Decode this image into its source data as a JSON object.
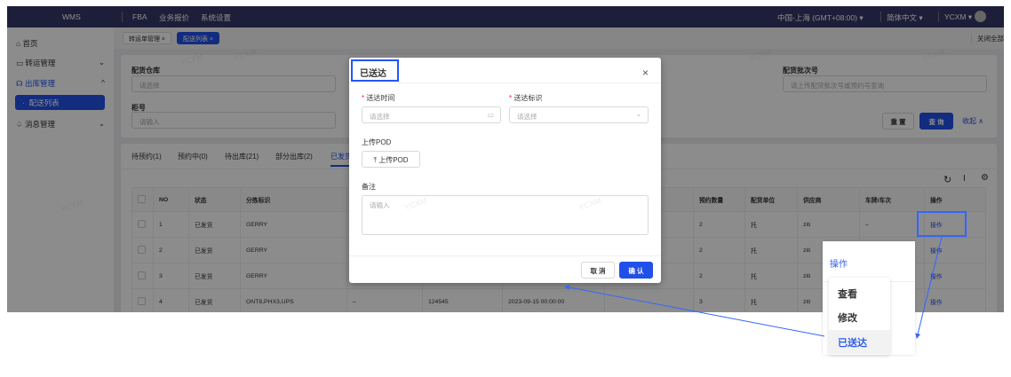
{
  "header": {
    "logo": "WMS",
    "nav": [
      "FBA",
      "业务报价",
      "系统设置"
    ],
    "timezone": "中国-上海 (GMT+08:00)",
    "language": "简体中文",
    "user": "YCXM"
  },
  "sidebar": {
    "items": [
      {
        "label": "首页",
        "icon": "home-icon"
      },
      {
        "label": "转运管理",
        "icon": "truck-icon"
      },
      {
        "label": "出库管理",
        "icon": "headset-icon"
      },
      {
        "label": "配送列表",
        "active": true
      },
      {
        "label": "消息管理",
        "icon": "bell-icon"
      }
    ]
  },
  "tags": {
    "items": [
      "转运单管理",
      "配送列表"
    ],
    "close_all": "关闭全部"
  },
  "filters": {
    "warehouse_label": "配货仓库",
    "warehouse_placeholder": "请选择",
    "container_label": "柜号",
    "container_placeholder": "请输入",
    "batch_label": "配货批次号",
    "batch_placeholder": "请上传配货批次号或预约号查询",
    "reset": "重 置",
    "query": "查 询",
    "collapse": "收起"
  },
  "status_tabs": [
    "待预约(1)",
    "预约中(0)",
    "待出库(21)",
    "部分出库(2)",
    "已发货"
  ],
  "table": {
    "headers": [
      "NO",
      "状态",
      "分拣标识",
      "",
      "",
      "",
      "",
      "预约数量",
      "配货单位",
      "供应商",
      "车牌/车次",
      "操作"
    ],
    "rows": [
      [
        "1",
        "已发货",
        "GERRY",
        "",
        "",
        "",
        "",
        "2",
        "托",
        "ziti",
        "–",
        "操作"
      ],
      [
        "2",
        "已发货",
        "GERRY",
        "",
        "",
        "",
        "",
        "2",
        "托",
        "ziti",
        "",
        "操作"
      ],
      [
        "3",
        "已发货",
        "GERRY",
        "",
        "",
        "",
        "",
        "2",
        "托",
        "ziti",
        "",
        "操作"
      ],
      [
        "4",
        "已发货",
        "ONT8,PHX3,UPS",
        "–",
        "124545",
        "2023-09-15 00:00:00",
        "",
        "3",
        "托",
        "ziti",
        "",
        "操作"
      ]
    ]
  },
  "modal": {
    "title": "已送达",
    "time_label": "送达时间",
    "time_placeholder": "请选择",
    "mark_label": "送达标识",
    "mark_placeholder": "请选择",
    "pod_label": "上传POD",
    "pod_button": "上传POD",
    "remark_label": "备注",
    "remark_placeholder": "请输入",
    "cancel": "取 消",
    "confirm": "确 认"
  },
  "popup": {
    "header": "操作",
    "items": [
      "查看",
      "修改",
      "已送达"
    ]
  },
  "watermark": "YCXM",
  "colors": {
    "accent": "#2150e8",
    "header_bg": "#353769",
    "annotation": "#3366ff"
  }
}
